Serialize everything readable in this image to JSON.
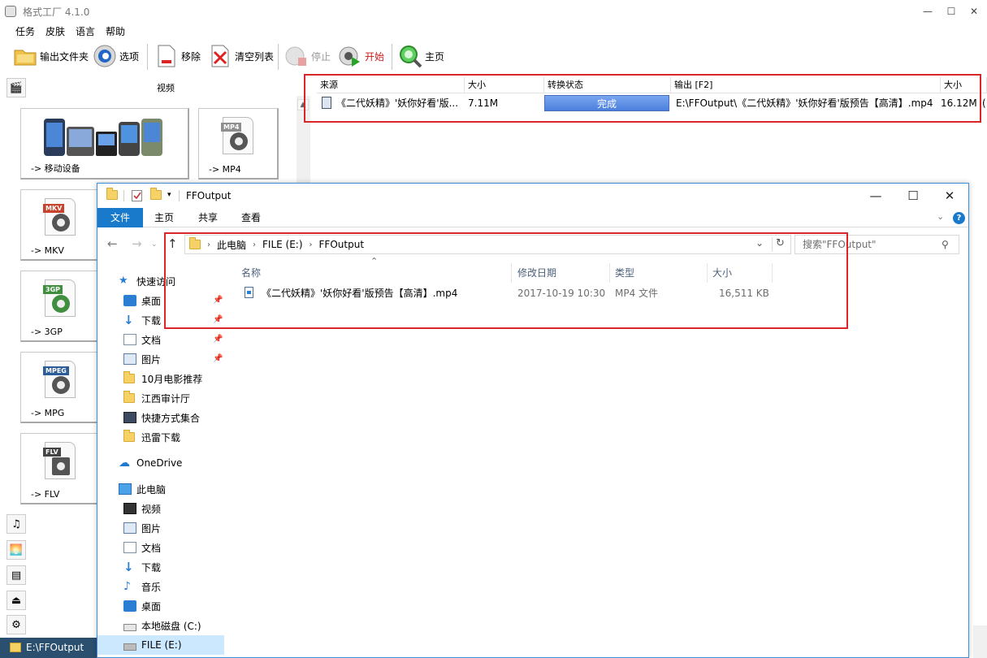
{
  "ff": {
    "title": "格式工厂 4.1.0",
    "controls": {
      "minimize": "—",
      "maximize": "☐",
      "close": "✕"
    },
    "menu": [
      "任务",
      "皮肤",
      "语言",
      "帮助"
    ],
    "toolbar": {
      "output_folder": "输出文件夹",
      "options": "选项",
      "remove": "移除",
      "clear_list": "清空列表",
      "stop": "停止",
      "start": "开始",
      "home": "主页"
    },
    "left_header": "视频",
    "cards": [
      {
        "label": "-> 移动设备",
        "tag": ""
      },
      {
        "label": "-> MP4",
        "tag": "MP4",
        "color": "#8e8e8e"
      },
      {
        "label": "-> MKV",
        "tag": "MKV",
        "color": "#c9422b"
      },
      {
        "label": "-> 3GP",
        "tag": "3GP",
        "color": "#3f8f3f"
      },
      {
        "label": "-> MPG",
        "tag": "MPEG",
        "color": "#2c5d9a"
      },
      {
        "label": "-> FLV",
        "tag": "FLV",
        "color": "#444444"
      }
    ],
    "table": {
      "headers": [
        "来源",
        "大小",
        "转换状态",
        "输出 [F2]",
        "大小"
      ],
      "row": {
        "source": "《二代妖精》'妖你好看'版...",
        "size": "7.11M",
        "status": "完成",
        "output": "E:\\FFOutput\\《二代妖精》'妖你好看'版预告【高清】.mp4",
        "out_size": "16.12M",
        "extra": "("
      }
    },
    "status_path": "E:\\FFOutput"
  },
  "explorer": {
    "title": "FFOutput",
    "controls": {
      "minimize": "—",
      "maximize": "☐",
      "close": "✕"
    },
    "ribbon_tabs": [
      "文件",
      "主页",
      "共享",
      "查看"
    ],
    "breadcrumb": [
      "此电脑",
      "FILE (E:)",
      "FFOutput"
    ],
    "search_placeholder": "搜索\"FFOutput\"",
    "columns": [
      "名称",
      "修改日期",
      "类型",
      "大小"
    ],
    "file": {
      "name": "《二代妖精》'妖你好看'版预告【高清】.mp4",
      "date": "2017-10-19 10:30",
      "type": "MP4 文件",
      "size": "16,511 KB"
    },
    "nav": {
      "quick_access": "快速访问",
      "quick_items": [
        "桌面",
        "下载",
        "文档",
        "图片",
        "10月电影推荐",
        "江西审计厅",
        "快捷方式集合",
        "迅雷下载"
      ],
      "onedrive": "OneDrive",
      "this_pc": "此电脑",
      "pc_items": [
        "视频",
        "图片",
        "文档",
        "下载",
        "音乐",
        "桌面",
        "本地磁盘 (C:)",
        "FILE (E:)"
      ]
    }
  }
}
